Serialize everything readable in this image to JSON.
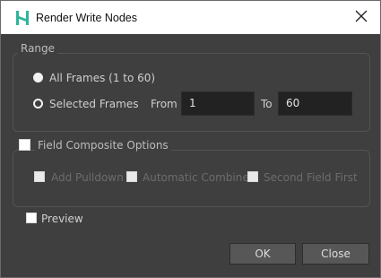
{
  "window": {
    "title": "Render Write Nodes",
    "app_icon": "harmony-h-icon",
    "close_icon": "close-icon"
  },
  "range": {
    "label": "Range",
    "all_frames_label": "All Frames (1 to 60)",
    "selected_frames_label": "Selected Frames",
    "from_label": "From",
    "from_value": "1",
    "to_label": "To",
    "to_value": "60",
    "selected_option": "all_frames"
  },
  "field_composite": {
    "label": "Field Composite Options",
    "checked": false,
    "options": [
      {
        "label": "Add Pulldown",
        "checked": false,
        "enabled": false
      },
      {
        "label": "Automatic Combine",
        "checked": false,
        "enabled": false
      },
      {
        "label": "Second Field First",
        "checked": false,
        "enabled": false
      }
    ]
  },
  "preview": {
    "label": "Preview",
    "checked": false
  },
  "buttons": {
    "ok": "OK",
    "close": "Close"
  },
  "colors": {
    "background": "#3f3f3f",
    "titlebar": "#ffffff",
    "accent": "#2fb59a",
    "field": "#222222"
  }
}
